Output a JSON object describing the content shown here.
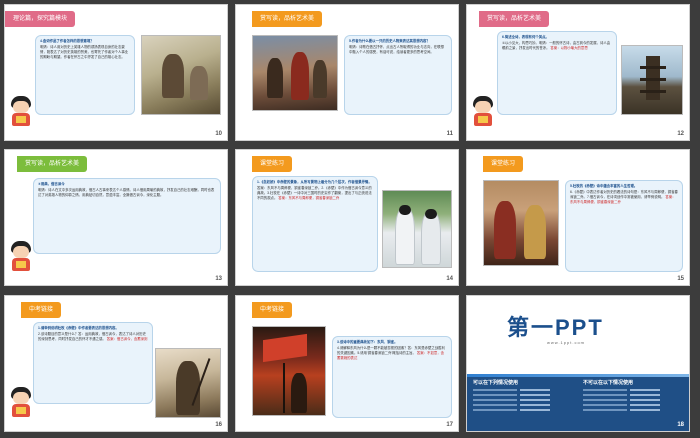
{
  "slides": [
    {
      "number": "10",
      "banner": "理论篇，探究篇模块",
      "question": "4.金词作品了作者怎样的思想意境？",
      "body": "明清：诗人用对历史上英雄人物的颂扬表现自身的壮志豪情，既表达了对历史英雄的赞美，也寄托了作者对个人事业的期盼与期望。作者在怀古之中抒发了自己的雄心壮志。"
    },
    {
      "number": "11",
      "banner": "赏写读，品析艺术美",
      "question": "5.作者为什么要以一只的历史人物来表达其思想内容？",
      "body": "明清：诗歌在借古抒怀，点出古人所取得的功业与志向，在联想中融入个人的感受，有话可说，给读者更多的思考空间。"
    },
    {
      "number": "12",
      "banner": "赏写读，品析艺术美",
      "question": "6.简述全诗，表现有何个美点。",
      "body": "①以小见大，构思巧妙。明清：一般的怀古诗，由古到今的发展，诗人由眼前之景，抒发出时代的苍凉。",
      "answer": "答案：以物小喻大的意思"
    },
    {
      "number": "13",
      "banner": "赏写读，品析艺术美",
      "question": "②用典，借古讽今",
      "body": "明清：诗人在文中多次运用典故，借古人古事来表达个人感情。诗人借用周瑜的典故，抒发自己的壮志难酬，同时也表达了对英雄人物的仰慕之情。用典贴切自然，意蕴丰富。全篇借古讽今，深化主题。"
    },
    {
      "number": "14",
      "banner": "课堂练习",
      "question": "1.《念奴娇》中赤壁的景象，从所写景物上看分为几个层次，作者借景抒情。",
      "body": "答案：东风不与周郎便，铜雀春深锁二乔。2.《赤壁》中作为借古讽今意义的典故。3.杜牧在《赤壁》一诗中对三国时的史实作了翻案，提出了与正统说法不同的观点。",
      "answer": "答案：东风不与周郎便，铜雀春深锁二乔"
    },
    {
      "number": "15",
      "banner": "课堂练习",
      "question": "5.杜牧的《赤壁》诗中蕴含丰富的人生哲理。",
      "body": "6.《赤壁》中表达作者对历史的看法的诗句是：东风不与周郎便，铜雀春深锁二乔。7.借古讽今，在诗词创作中常被使用，请举例说明。",
      "answer": "答案：东风不与周郎便，铜雀春深锁二乔"
    },
    {
      "number": "16",
      "banner": "中考链接",
      "question": "1.请举例说明杜牧《赤壁》中作者要表达的思想内容。",
      "body": "2.该诗题目的意义是什么？答：运用典故，借古讽今，表达了诗人对历史的深刻思考，同时抒发自己的怀才不遇之感。",
      "answer": "答案：借古讽今，含蓄深刻"
    },
    {
      "number": "17",
      "banner": "中考链接",
      "question": "3.该诗中的重要典故如下：东风、铜雀。",
      "body": "4.请解释东风为什么是一颗不能被忽视的因素？答：东风是赤壁之战胜利的关键因素。5.请用‘铜雀春深锁二乔’概括诗的主旨。",
      "answer": "答案：不如意，含蓄委婉的表达"
    },
    {
      "number": "18",
      "logo_main": "第一PPT",
      "logo_url": "www.1ppt.com",
      "col_left_head": "可以在下列情况使用",
      "col_right_head": "不可以在以下情况使用"
    }
  ]
}
